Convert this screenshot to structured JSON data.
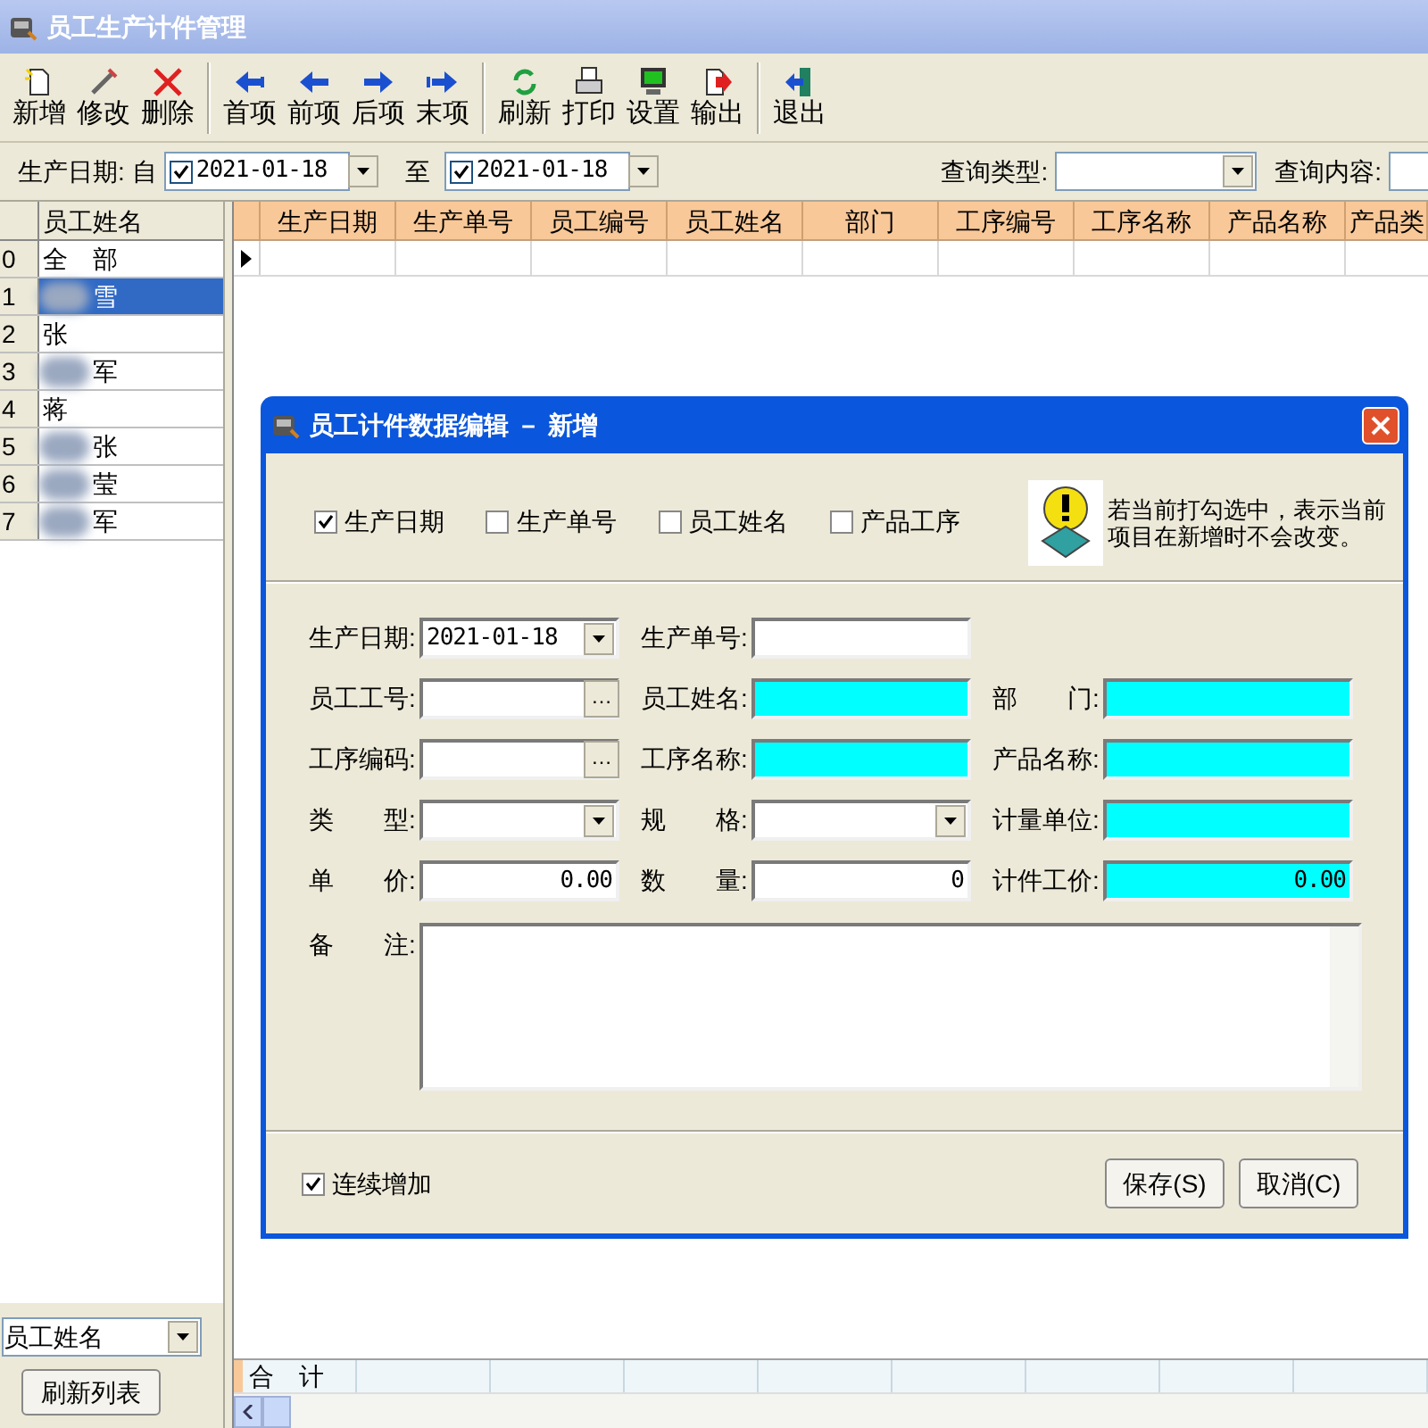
{
  "window": {
    "title": "员工生产计件管理"
  },
  "toolbar_groups": [
    {
      "buttons": [
        {
          "label": "新增",
          "kind": "new"
        },
        {
          "label": "修改",
          "kind": "edit"
        },
        {
          "label": "删除",
          "kind": "delete"
        }
      ]
    },
    {
      "buttons": [
        {
          "label": "首项",
          "kind": "first"
        },
        {
          "label": "前项",
          "kind": "prev"
        },
        {
          "label": "后项",
          "kind": "next"
        },
        {
          "label": "末项",
          "kind": "last"
        }
      ]
    },
    {
      "buttons": [
        {
          "label": "刷新",
          "kind": "refresh"
        },
        {
          "label": "打印",
          "kind": "print"
        },
        {
          "label": "设置",
          "kind": "settings"
        },
        {
          "label": "输出",
          "kind": "export"
        }
      ]
    },
    {
      "buttons": [
        {
          "label": "退出",
          "kind": "exit"
        }
      ]
    }
  ],
  "filter": {
    "date_label": "生产日期:",
    "from_label": "自",
    "from_date": {
      "checked": true,
      "value": "2021-01-18"
    },
    "to_label": "至",
    "to_date": {
      "checked": true,
      "value": "2021-01-18"
    },
    "query_type_label": "查询类型:",
    "query_content_label": "查询内容:"
  },
  "employee_list": {
    "header": "员工姓名",
    "rows": [
      {
        "index": "0",
        "name": "全　部",
        "redacted": false,
        "selected": false
      },
      {
        "index": "1",
        "name": "雪",
        "redacted": true,
        "selected": true
      },
      {
        "index": "2",
        "name": "张",
        "redacted": false,
        "selected": false
      },
      {
        "index": "3",
        "name": "军",
        "redacted": true,
        "selected": false
      },
      {
        "index": "4",
        "name": "蒋",
        "redacted": false,
        "selected": false
      },
      {
        "index": "5",
        "name": "张",
        "redacted": true,
        "selected": false
      },
      {
        "index": "6",
        "name": "莹",
        "redacted": true,
        "selected": false
      },
      {
        "index": "7",
        "name": "军",
        "redacted": true,
        "selected": false
      }
    ]
  },
  "left_footer": {
    "field_combo": "员工姓名",
    "refresh_button": "刷新列表"
  },
  "grid": {
    "columns": [
      "生产日期",
      "生产单号",
      "员工编号",
      "员工姓名",
      "部门",
      "工序编号",
      "工序名称",
      "产品名称",
      "产品类"
    ],
    "total_label": "合　计"
  },
  "dialog": {
    "title": "员工计件数据编辑 － 新增",
    "keep_options": [
      {
        "label": "生产日期",
        "checked": true
      },
      {
        "label": "生产单号",
        "checked": false
      },
      {
        "label": "员工姓名",
        "checked": false
      },
      {
        "label": "产品工序",
        "checked": false
      }
    ],
    "hint": "若当前打勾选中，表示当前项目在新增时不会改变。",
    "fields": [
      {
        "label": "生产日期:",
        "kind": "combo",
        "value": "2021-01-18",
        "readonly": false
      },
      {
        "label": "生产单号:",
        "kind": "text",
        "readonly": false
      },
      {
        "kind": "empty"
      },
      {
        "label": "员工工号:",
        "kind": "lookup",
        "browse_label": "…",
        "readonly": false
      },
      {
        "label": "员工姓名:",
        "kind": "text",
        "readonly": true
      },
      {
        "label": "部　　门:",
        "kind": "text",
        "readonly": true
      },
      {
        "label": "工序编码:",
        "kind": "lookup",
        "browse_label": "…",
        "readonly": false
      },
      {
        "label": "工序名称:",
        "kind": "text",
        "readonly": true
      },
      {
        "label": "产品名称:",
        "kind": "text",
        "readonly": true
      },
      {
        "label": "类　　型:",
        "kind": "combo",
        "readonly": false
      },
      {
        "label": "规　　格:",
        "kind": "combo",
        "readonly": false
      },
      {
        "label": "计量单位:",
        "kind": "text",
        "readonly": true
      },
      {
        "label": "单　　价:",
        "kind": "number",
        "value": "0.00",
        "readonly": false
      },
      {
        "label": "数　　量:",
        "kind": "number",
        "value": "0",
        "readonly": false
      },
      {
        "label": "计件工价:",
        "kind": "number",
        "value": "0.00",
        "readonly": true
      }
    ],
    "memo_label": "备　　注:",
    "continuous": {
      "label": "连续增加",
      "checked": true
    },
    "buttons": [
      "保存(S)",
      "取消(C)"
    ]
  }
}
